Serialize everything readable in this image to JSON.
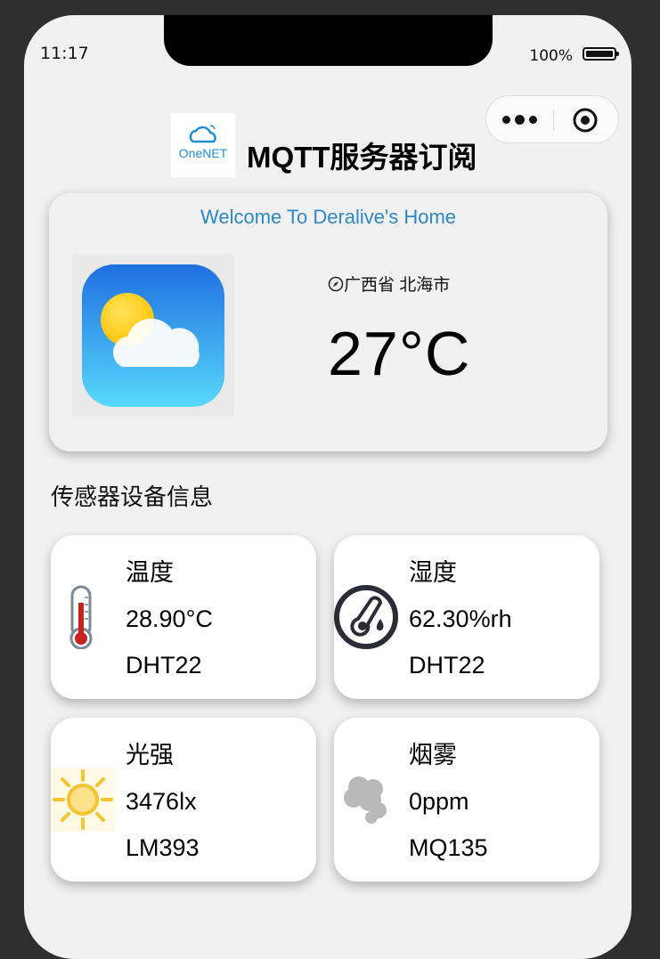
{
  "status_bar": {
    "time": "11:17",
    "battery": "100%"
  },
  "header": {
    "logo_text": "OneNET",
    "title": "MQTT服务器订阅"
  },
  "weather": {
    "welcome": "Welcome To Deralive's Home",
    "location": "广西省 北海市",
    "temperature": "27°C",
    "icon": "weather-partly-cloudy-icon"
  },
  "section_title": "传感器设备信息",
  "sensors": [
    {
      "name": "温度",
      "value": "28.90°C",
      "device": "DHT22",
      "icon": "thermometer-icon"
    },
    {
      "name": "湿度",
      "value": "62.30%rh",
      "device": "DHT22",
      "icon": "humidity-icon"
    },
    {
      "name": "光强",
      "value": "3476lx",
      "device": "LM393",
      "icon": "sun-icon"
    },
    {
      "name": "烟雾",
      "value": "0ppm",
      "device": "MQ135",
      "icon": "smoke-icon"
    }
  ],
  "colors": {
    "accent": "#2b88c9",
    "background": "#f1f1f1",
    "card": "#ffffff"
  }
}
